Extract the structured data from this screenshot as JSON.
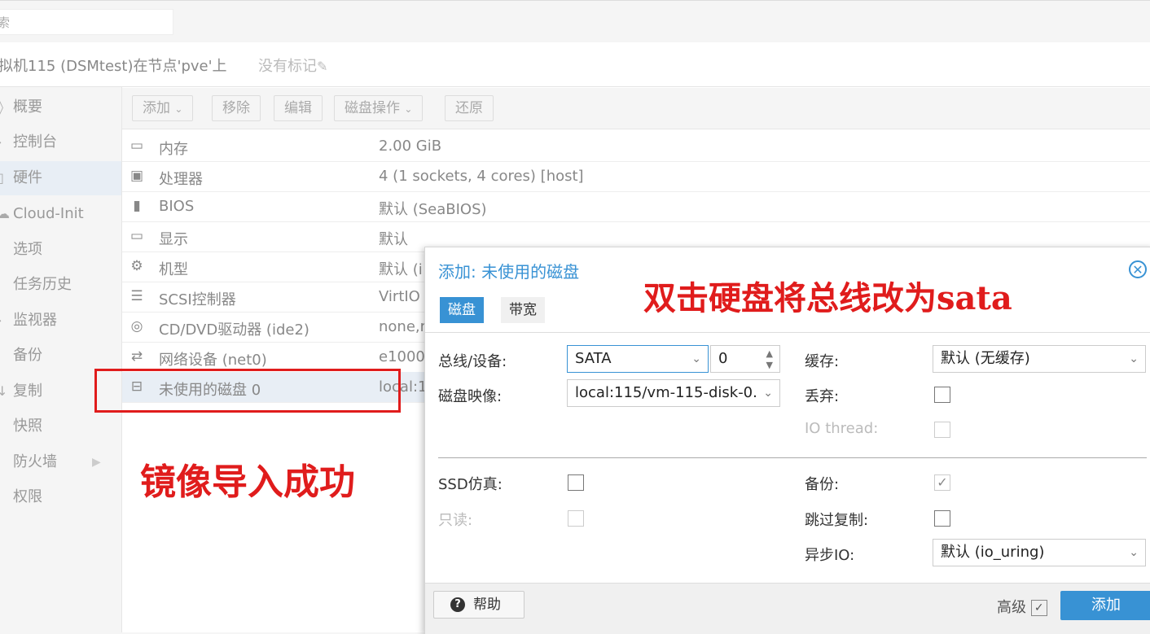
{
  "search": {
    "placeholder": "索"
  },
  "header": {
    "vm_title": "拟机115 (DSMtest)在节点'pve'上",
    "tags": "没有标记"
  },
  "sidebar": {
    "items": [
      {
        "label": "概要",
        "icon": "summary-icon"
      },
      {
        "label": "控制台",
        "icon": "console-icon"
      },
      {
        "label": "硬件",
        "icon": "hardware-icon"
      },
      {
        "label": "Cloud-Init",
        "icon": "cloud-icon"
      },
      {
        "label": "选项",
        "icon": "options-icon"
      },
      {
        "label": "任务历史",
        "icon": "history-icon"
      },
      {
        "label": "监视器",
        "icon": "monitor-icon"
      },
      {
        "label": "备份",
        "icon": "backup-icon"
      },
      {
        "label": "复制",
        "icon": "replication-icon"
      },
      {
        "label": "快照",
        "icon": "snapshot-icon"
      },
      {
        "label": "防火墙",
        "icon": "firewall-icon"
      },
      {
        "label": "权限",
        "icon": "permissions-icon"
      }
    ]
  },
  "toolbar": {
    "add": "添加",
    "remove": "移除",
    "edit": "编辑",
    "disk_action": "磁盘操作",
    "revert": "还原"
  },
  "hardware": [
    {
      "key": "内存",
      "value": "2.00 GiB",
      "icon": "memory-icon"
    },
    {
      "key": "处理器",
      "value": "4 (1 sockets, 4 cores) [host]",
      "icon": "cpu-icon"
    },
    {
      "key": "BIOS",
      "value": "默认 (SeaBIOS)",
      "icon": "bios-icon"
    },
    {
      "key": "显示",
      "value": "默认",
      "icon": "display-icon"
    },
    {
      "key": "机型",
      "value": "默认 (i",
      "icon": "machine-icon"
    },
    {
      "key": "SCSI控制器",
      "value": "VirtIO",
      "icon": "scsi-icon"
    },
    {
      "key": "CD/DVD驱动器 (ide2)",
      "value": "none,m",
      "icon": "cdrom-icon"
    },
    {
      "key": "网络设备 (net0)",
      "value": "e1000",
      "icon": "network-icon"
    },
    {
      "key": "未使用的磁盘 0",
      "value": "local:1",
      "icon": "hdd-icon"
    }
  ],
  "annotations": {
    "import_success": "镜像导入成功",
    "change_bus": "双击硬盘将总线改为sata"
  },
  "dialog": {
    "title": "添加: 未使用的磁盘",
    "tabs": [
      "磁盘",
      "带宽"
    ],
    "bus_label": "总线/设备:",
    "bus_value": "SATA",
    "device_value": "0",
    "image_label": "磁盘映像:",
    "image_value": "local:115/vm-115-disk-0.",
    "cache_label": "缓存:",
    "cache_value": "默认 (无缓存)",
    "discard_label": "丢弃:",
    "iothread_label": "IO thread:",
    "ssd_label": "SSD仿真:",
    "readonly_label": "只读:",
    "backup_label": "备份:",
    "skip_repl_label": "跳过复制:",
    "async_io_label": "异步IO:",
    "async_io_value": "默认 (io_uring)",
    "help": "帮助",
    "advanced": "高级",
    "add": "添加"
  }
}
